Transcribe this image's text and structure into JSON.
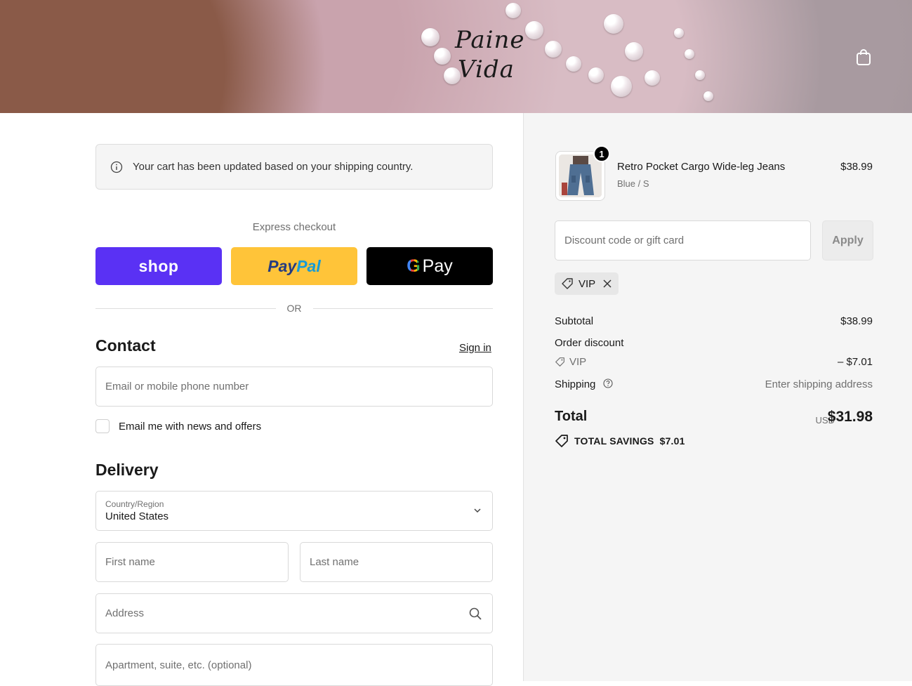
{
  "header": {
    "logo_line1": "Paine",
    "logo_line2": "Vida"
  },
  "notice": {
    "text": "Your cart has been updated based on your shipping country."
  },
  "express": {
    "title": "Express checkout",
    "shop_label": "shop",
    "paypal_part1": "Pay",
    "paypal_part2": "Pal",
    "gpay_g": "G",
    "gpay_label": "Pay",
    "or_label": "OR"
  },
  "contact": {
    "title": "Contact",
    "signin_label": "Sign in",
    "email_placeholder": "Email or mobile phone number",
    "newsletter_label": "Email me with news and offers"
  },
  "delivery": {
    "title": "Delivery",
    "country_label": "Country/Region",
    "country_value": "United States",
    "first_name_placeholder": "First name",
    "last_name_placeholder": "Last name",
    "address_placeholder": "Address",
    "apartment_placeholder": "Apartment, suite, etc. (optional)"
  },
  "cart": {
    "item": {
      "quantity": "1",
      "name": "Retro Pocket Cargo Wide-leg Jeans",
      "variant": "Blue / S",
      "price": "$38.99"
    },
    "discount_placeholder": "Discount code or gift card",
    "apply_label": "Apply",
    "applied_code": "VIP"
  },
  "summary": {
    "subtotal_label": "Subtotal",
    "subtotal_value": "$38.99",
    "order_discount_label": "Order discount",
    "discount_code": "VIP",
    "discount_value": "– $7.01",
    "shipping_label": "Shipping",
    "shipping_value": "Enter shipping address",
    "total_label": "Total",
    "total_currency": "USD",
    "total_value": "$31.98",
    "savings_label": "TOTAL SAVINGS",
    "savings_value": "$7.01"
  },
  "colors": {
    "shop_purple": "#5a31f4",
    "paypal_yellow": "#ffc439",
    "gpay_black": "#000000",
    "summary_bg": "#f5f5f5"
  }
}
